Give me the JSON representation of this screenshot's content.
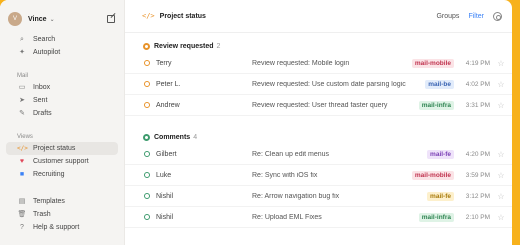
{
  "colors": {
    "background": "#f7b11c",
    "accent_orange": "#e8932a",
    "accent_green": "#3e9b6e",
    "filter_blue": "#3b82f6"
  },
  "sidebar": {
    "user": {
      "name": "Vince",
      "avatar_initial": "V"
    },
    "top_items": [
      {
        "label": "Search",
        "icon": "search-icon"
      },
      {
        "label": "Autopilot",
        "icon": "autopilot-icon"
      }
    ],
    "mail_label": "Mail",
    "mail_items": [
      {
        "label": "Inbox",
        "icon": "inbox-icon"
      },
      {
        "label": "Sent",
        "icon": "sent-icon"
      },
      {
        "label": "Drafts",
        "icon": "drafts-icon"
      }
    ],
    "views_label": "Views",
    "view_items": [
      {
        "label": "Project status",
        "icon": "code-icon",
        "active": true
      },
      {
        "label": "Customer support",
        "icon": "heart-icon",
        "active": false
      },
      {
        "label": "Recruiting",
        "icon": "briefcase-icon",
        "active": false
      }
    ],
    "bottom_items": [
      {
        "label": "Templates",
        "icon": "templates-icon"
      },
      {
        "label": "Trash",
        "icon": "trash-icon"
      },
      {
        "label": "Help & support",
        "icon": "help-icon"
      }
    ]
  },
  "header": {
    "icon": "</>",
    "title": "Project status",
    "groups_label": "Groups",
    "filter_label": "Filter"
  },
  "groups": [
    {
      "name": "Review requested",
      "count": "2",
      "color": "#e8932a",
      "rows": [
        {
          "sender": "Terry",
          "subject": "Review requested: Mobile login",
          "tag": "mail-mobile",
          "tag_bg": "#fbe3e6",
          "tag_fg": "#c0334f",
          "time": "4:19 PM"
        },
        {
          "sender": "Peter L.",
          "subject": "Review requested: Use custom date parsing logic",
          "tag": "mail-be",
          "tag_bg": "#e2ecfb",
          "tag_fg": "#3a64b3",
          "time": "4:02 PM"
        },
        {
          "sender": "Andrew",
          "subject": "Review requested: User thread faster query",
          "tag": "mail-infra",
          "tag_bg": "#dff3e6",
          "tag_fg": "#2f8552",
          "time": "3:31 PM"
        }
      ]
    },
    {
      "name": "Comments",
      "count": "4",
      "color": "#3e9b6e",
      "rows": [
        {
          "sender": "Gilbert",
          "subject": "Re: Clean up edit menus",
          "tag": "mail-fe",
          "tag_bg": "#efe3fa",
          "tag_fg": "#7b40b5",
          "time": "4:20 PM"
        },
        {
          "sender": "Luke",
          "subject": "Re: Sync with iOS fix",
          "tag": "mail-mobile",
          "tag_bg": "#fbe3e6",
          "tag_fg": "#c0334f",
          "time": "3:59 PM"
        },
        {
          "sender": "Nishil",
          "subject": "Re: Arrow navigation bug fix",
          "tag": "mail-fe",
          "tag_bg": "#fdf0cc",
          "tag_fg": "#a77a0b",
          "time": "3:12 PM"
        },
        {
          "sender": "Nishil",
          "subject": "Re: Upload EML Fixes",
          "tag": "mail-infra",
          "tag_bg": "#dff3e6",
          "tag_fg": "#2f8552",
          "time": "2:10 PM"
        }
      ]
    }
  ]
}
